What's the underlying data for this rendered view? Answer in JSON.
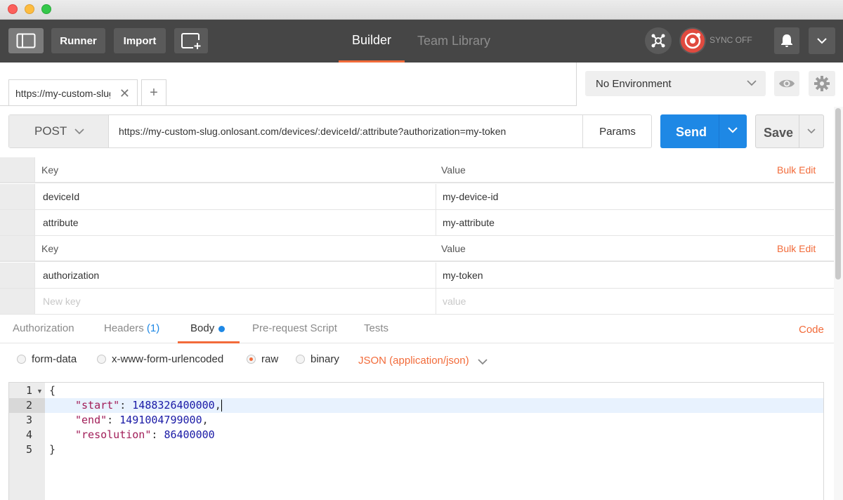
{
  "header": {
    "runner_label": "Runner",
    "import_label": "Import",
    "tabs": [
      {
        "label": "Builder",
        "active": true
      },
      {
        "label": "Team Library",
        "active": false
      }
    ],
    "sync_label": "SYNC OFF",
    "accent_color": "#f26b3a"
  },
  "request_tab": {
    "label": "https://my-custom-slug",
    "close_glyph": "✕",
    "add_glyph": "+"
  },
  "environment": {
    "selected": "No Environment"
  },
  "request": {
    "method": "POST",
    "url": "https://my-custom-slug.onlosant.com/devices/:deviceId/:attribute?authorization=my-token",
    "params_label": "Params",
    "send_label": "Send",
    "save_label": "Save",
    "send_color": "#1e88e5"
  },
  "path_vars": {
    "key_header": "Key",
    "value_header": "Value",
    "bulk_edit": "Bulk Edit",
    "rows": [
      {
        "key": "deviceId",
        "value": "my-device-id"
      },
      {
        "key": "attribute",
        "value": "my-attribute"
      }
    ]
  },
  "query_params": {
    "key_header": "Key",
    "value_header": "Value",
    "bulk_edit": "Bulk Edit",
    "rows": [
      {
        "key": "authorization",
        "value": "my-token"
      }
    ],
    "new_key_placeholder": "New key",
    "new_value_placeholder": "value"
  },
  "body_tabs": {
    "authorization": "Authorization",
    "headers": "Headers",
    "headers_count": "(1)",
    "body": "Body",
    "pre_request": "Pre-request Script",
    "tests": "Tests",
    "code": "Code"
  },
  "body_modes": {
    "form_data": "form-data",
    "urlencoded": "x-www-form-urlencoded",
    "raw": "raw",
    "binary": "binary",
    "selected": "raw",
    "content_type": "JSON (application/json)"
  },
  "editor": {
    "line_numbers": [
      "1",
      "2",
      "3",
      "4",
      "5"
    ],
    "lines": {
      "l1": "{",
      "l2_key": "\"start\"",
      "l2_sep": ": ",
      "l2_val": "1488326400000",
      "l2_end": ",",
      "l3_key": "\"end\"",
      "l3_sep": ": ",
      "l3_val": "1491004799000",
      "l3_end": ",",
      "l4_key": "\"resolution\"",
      "l4_sep": ": ",
      "l4_val": "86400000",
      "l5": "}"
    }
  }
}
